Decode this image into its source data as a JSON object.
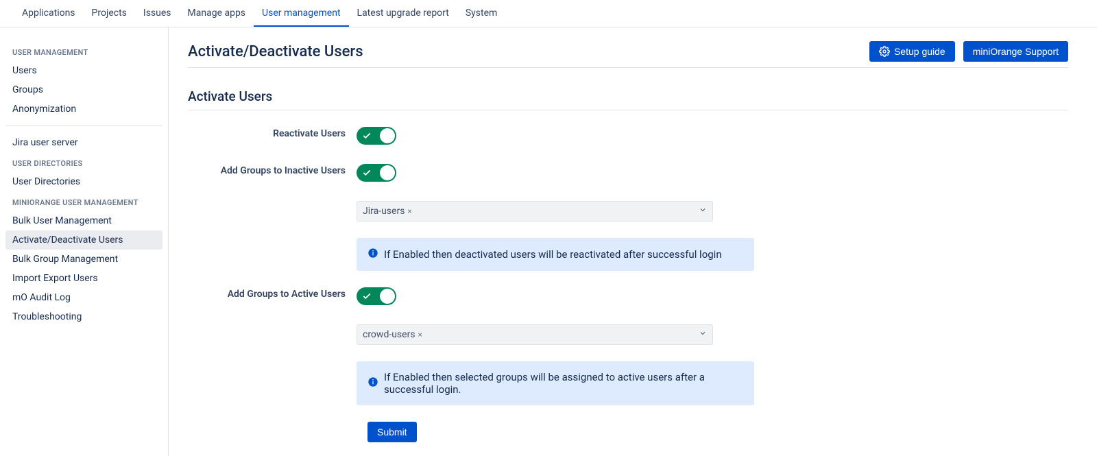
{
  "topnav": {
    "items": [
      {
        "label": "Applications"
      },
      {
        "label": "Projects"
      },
      {
        "label": "Issues"
      },
      {
        "label": "Manage apps"
      },
      {
        "label": "User management"
      },
      {
        "label": "Latest upgrade report"
      },
      {
        "label": "System"
      }
    ],
    "active_index": 4
  },
  "sidebar": {
    "sections": [
      {
        "title": "USER MANAGEMENT",
        "items": [
          "Users",
          "Groups",
          "Anonymization"
        ]
      },
      {
        "title": "",
        "items": [
          "Jira user server"
        ]
      },
      {
        "title": "USER DIRECTORIES",
        "items": [
          "User Directories"
        ]
      },
      {
        "title": "MINIORANGE USER MANAGEMENT",
        "items": [
          "Bulk User Management",
          "Activate/Deactivate Users",
          "Bulk Group Management",
          "Import Export Users",
          "mO Audit Log",
          "Troubleshooting"
        ]
      }
    ],
    "active": "Activate/Deactivate Users"
  },
  "header": {
    "title": "Activate/Deactivate Users",
    "setup_guide": "Setup guide",
    "support": "miniOrange Support"
  },
  "section": {
    "title": "Activate Users"
  },
  "form": {
    "reactivate_label": "Reactivate Users",
    "add_groups_inactive_label": "Add Groups to Inactive Users",
    "inactive_group_chip": "Jira-users",
    "info1": "If Enabled then deactivated users will be reactivated after successful login",
    "add_groups_active_label": "Add Groups to Active Users",
    "active_group_chip": "crowd-users",
    "info2": "If Enabled then selected groups will be assigned to active users after a successful login.",
    "submit": "Submit"
  }
}
